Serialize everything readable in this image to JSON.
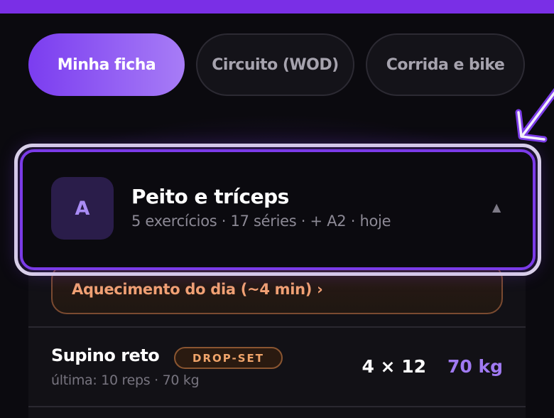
{
  "tabs": [
    {
      "label": "Minha ficha",
      "active": true
    },
    {
      "label": "Circuito (WOD)",
      "active": false
    },
    {
      "label": "Corrida e bike",
      "active": false
    }
  ],
  "workout_card": {
    "letter": "A",
    "title": "Peito e tríceps",
    "subtitle": "5 exercícios · 17 séries · + A2 · hoje",
    "expanded_indicator": "▲"
  },
  "warmup": {
    "label": "Aquecimento do dia (~4 min) ›"
  },
  "exercises": [
    {
      "name": "Supino reto",
      "badge": "DROP-SET",
      "last": "última: 10 reps · 70 kg",
      "sets": "4 × 12",
      "weight": "70 kg"
    }
  ],
  "colors": {
    "accent": "#7b3be8",
    "accent_light": "#a07af2",
    "warmup": "#f1a174",
    "background": "#0b0a0f"
  },
  "icons": {
    "highlight_arrow": "arrow-down-left-icon",
    "caret": "caret-up-icon"
  }
}
